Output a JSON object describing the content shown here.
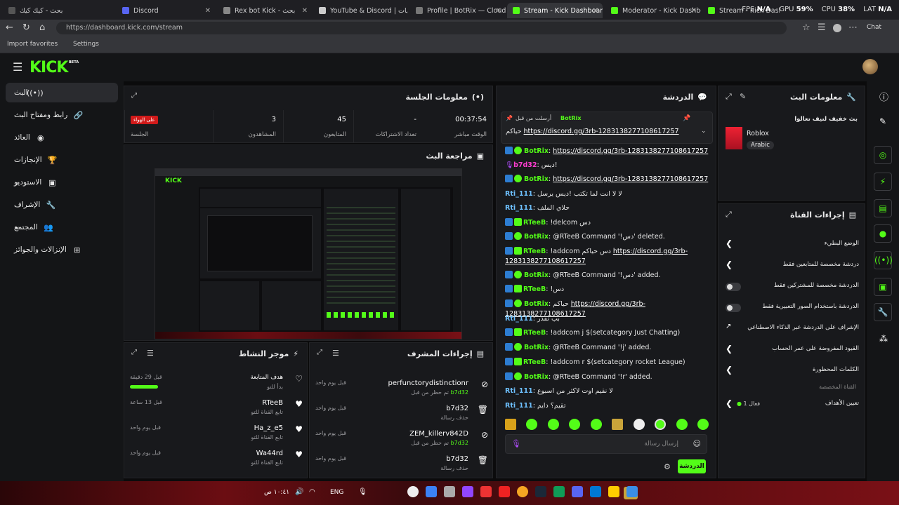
{
  "browser": {
    "tabs": [
      {
        "label": "بحث - كيك كيك"
      },
      {
        "label": "Discord"
      },
      {
        "label": "Rex bot Kick - بحث"
      },
      {
        "label": "YouTube & Discord | التنبيهات"
      },
      {
        "label": "Profile | BotRix — Cloud Stre"
      },
      {
        "label": "Stream - Kick Dashboard"
      },
      {
        "label": "Moderator - Kick Dashboard"
      },
      {
        "label": "Stream - Kick Dashboard"
      }
    ],
    "url": "https://dashboard.kick.com/stream",
    "bookmarks": [
      "Import favorites",
      "Settings"
    ],
    "chat_button": "Chat"
  },
  "hud": {
    "fps_label": "FPS",
    "fps": "N/A",
    "gpu_label": "GPU",
    "gpu": "59%",
    "cpu_label": "CPU",
    "cpu": "38%",
    "lat_label": "LAT",
    "lat": "N/A"
  },
  "kick": {
    "logo": "KICK",
    "beta": "BETA"
  },
  "sidebar": {
    "items": [
      {
        "label": "البث",
        "icon": "broadcast-icon"
      },
      {
        "label": "رابط ومفتاح البث",
        "icon": "link-icon"
      },
      {
        "label": "العائد",
        "icon": "money-icon"
      },
      {
        "label": "الإنجازات",
        "icon": "trophy-icon"
      },
      {
        "label": "الاستوديو",
        "icon": "studio-icon"
      },
      {
        "label": "الإشراف",
        "icon": "wrench-icon"
      },
      {
        "label": "المجتمع",
        "icon": "community-icon"
      },
      {
        "label": "الإنزالات والجوائز",
        "icon": "drops-icon"
      }
    ]
  },
  "session": {
    "title": "معلومات الجلسة",
    "stats": [
      {
        "value": "00:37:54",
        "label": "الوقت مباشر"
      },
      {
        "value": "-",
        "label": "تعداد الاشتراكات"
      },
      {
        "value": "45",
        "label": "المتابعون"
      },
      {
        "value": "3",
        "label": "المشاهدون"
      },
      {
        "value": "",
        "label": "الجلسة"
      }
    ],
    "live_badge": "على الهواء"
  },
  "preview": {
    "title": "مراجعة البث"
  },
  "activity": {
    "title": "موجز النشاط",
    "items": [
      {
        "name": "هدف المتابعة",
        "sub": "بدأ للتو",
        "time": "قبل 29 دقيقة"
      },
      {
        "name": "RTeeB",
        "sub": "تابع القناة للتو",
        "time": "قبل 13 ساعة"
      },
      {
        "name": "Ha_z_e5",
        "sub": "تابع القناة للتو",
        "time": "قبل يوم واحد"
      },
      {
        "name": "Wa44rd",
        "sub": "تابع القناة للتو",
        "time": "قبل يوم واحد"
      }
    ]
  },
  "mod_actions": {
    "title": "إجراءات المشرف",
    "items": [
      {
        "name": "perfunctorydistinctionr",
        "sub": "تم حظر من قبل",
        "by": "b7d32",
        "time": "قبل يوم واحد"
      },
      {
        "name": "b7d32",
        "sub": "حذف رسالة",
        "by": "",
        "time": "قبل يوم واحد"
      },
      {
        "name": "ZEM_killerv842D",
        "sub": "تم حظر من قبل",
        "by": "b7d32",
        "time": "قبل يوم واحد"
      },
      {
        "name": "b7d32",
        "sub": "حذف رسالة",
        "by": "",
        "time": "قبل يوم واحد"
      }
    ]
  },
  "chat": {
    "title": "الدردشة",
    "pinned": {
      "by_label": "أرسلت من قبل",
      "by": "BotRix",
      "text_prefix": "حياكم",
      "link": "https://discord.gg/3rb-1283138277108617257"
    },
    "messages": [
      {
        "user": "BotRix",
        "cls": "u-bot",
        "text": "",
        "link": "https://discord.gg/3rb-1283138277108617257"
      },
      {
        "user": "b7d32",
        "cls": "u-b7",
        "text": "ديس!",
        "link": ""
      },
      {
        "user": "BotRix",
        "cls": "u-bot",
        "text": "",
        "link": "https://discord.gg/3rb-1283138277108617257"
      },
      {
        "user": "Rti_111",
        "cls": "u-rtl",
        "text": "لا لا انت لما تكتب !ديس يرسل",
        "link": ""
      },
      {
        "user": "Rti_111",
        "cls": "u-rtl",
        "text": "حلاي الملف",
        "link": ""
      },
      {
        "user": "RTeeB",
        "cls": "u-rtee",
        "text": "!delcom دس",
        "link": ""
      },
      {
        "user": "BotRix",
        "cls": "u-bot",
        "text": "@RTeeB Command '!دس' deleted.",
        "link": ""
      },
      {
        "user": "RTeeB",
        "cls": "u-rtee",
        "text": "!addcom دس حياكم",
        "link": "https://discord.gg/3rb-1283138277108617257"
      },
      {
        "user": "BotRix",
        "cls": "u-bot",
        "text": "@RTeeB Command '!دس' added.",
        "link": ""
      },
      {
        "user": "RTeeB",
        "cls": "u-rtee",
        "text": "!دس",
        "link": ""
      },
      {
        "user": "BotRix",
        "cls": "u-bot",
        "text": "حياكم",
        "link": "https://discord.gg/3rb-1283138277108617257"
      },
      {
        "user": "Rti_111",
        "cls": "u-rtl",
        "text": "بب نفدر",
        "link": ""
      },
      {
        "user": "RTeeB",
        "cls": "u-rtee",
        "text": "!addcom j $(setcategory Just Chatting)",
        "link": ""
      },
      {
        "user": "BotRix",
        "cls": "u-bot",
        "text": "@RTeeB Command '!j' added.",
        "link": ""
      },
      {
        "user": "RTeeB",
        "cls": "u-rtee",
        "text": "!addcom r $(setcategory rocket League)",
        "link": ""
      },
      {
        "user": "BotRix",
        "cls": "u-bot",
        "text": "@RTeeB Command '!r' added.",
        "link": ""
      },
      {
        "user": "Rti_111",
        "cls": "u-rtl",
        "text": "لا نقيم اوت لاكثر من اسبوع",
        "link": ""
      },
      {
        "user": "Rti_111",
        "cls": "u-rtl",
        "text": "تقيم؟ دايم",
        "link": ""
      }
    ],
    "input_placeholder": "إرسال رسالة",
    "send_label": "الدردشة"
  },
  "stream_info": {
    "title": "معلومات البث",
    "stream_title": "بث خفيف لنيف تعالوا",
    "category": "Roblox",
    "language": "Arabic"
  },
  "channel_actions": {
    "title": "إجراءات القناة",
    "items": [
      {
        "label": "الوضع البطيء",
        "control": "chevron"
      },
      {
        "label": "دردشة مخصصة للمتابعين فقط",
        "control": "chevron"
      },
      {
        "label": "الدردشة مخصصة للمشتركين فقط",
        "control": "toggle"
      },
      {
        "label": "الدردشة باستخدام الصور التعبيرية فقط",
        "control": "toggle"
      },
      {
        "label": "الإشراف على الدردشة عبر الذكاء الاصطناعي",
        "control": "external"
      },
      {
        "label": "القيود المفروضة على عمر الحساب",
        "control": "chevron"
      },
      {
        "label": "الكلمات المحظورة",
        "control": "chevron"
      }
    ],
    "section_label": "القناة المخصصة",
    "goal_label": "تعيين الأهداف",
    "goal_status": "فعال 1"
  },
  "taskbar": {
    "time": "١٠:٤١ ص",
    "lang": "ENG"
  }
}
